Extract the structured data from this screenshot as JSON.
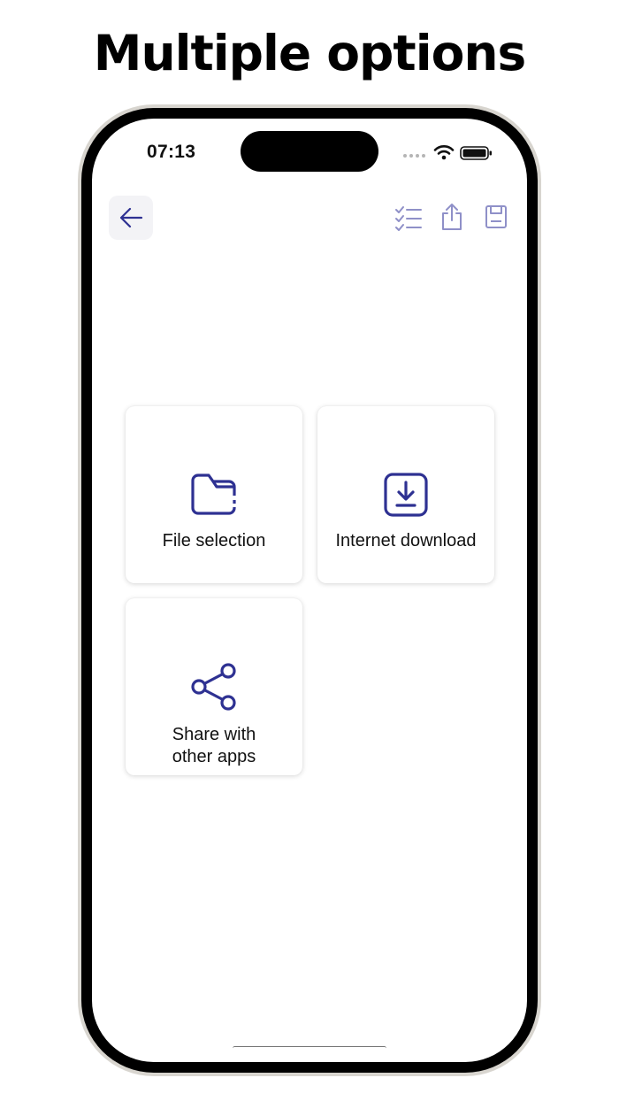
{
  "headline": "Multiple options",
  "status_bar": {
    "time": "07:13"
  },
  "toolbar": {
    "icons": [
      "arrow-left-icon",
      "checklist-icon",
      "share-upload-icon",
      "floppy-save-icon"
    ],
    "accent_color": "#2e3192",
    "muted_icon_color": "#8f90c8"
  },
  "options": [
    {
      "label": "File selection",
      "icon": "folder-icon"
    },
    {
      "label": "Internet download",
      "icon": "download-box-icon"
    },
    {
      "label_line1": "Share with",
      "label_line2": "other apps",
      "icon": "share-nodes-icon"
    }
  ]
}
